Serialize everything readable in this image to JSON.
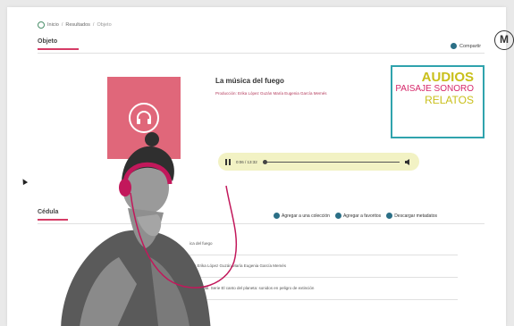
{
  "breadcrumb": {
    "home": "Inicio",
    "sep": "/",
    "results": "Resultados",
    "current": "Objeto"
  },
  "sections": {
    "objeto": "Objeto",
    "cedula": "Cédula"
  },
  "share_label": "Compartir",
  "brand_initial": "M",
  "item": {
    "title": "La música del fuego",
    "credit": "Producción: Erika López Guzán  María Eugenia García Memés"
  },
  "promo": {
    "line1": "AUDIOS",
    "line2": "PAISAJE SONORO",
    "line3": "RELATOS"
  },
  "player": {
    "time": "0:06 / 13:32",
    "progress": 0.0
  },
  "actions": {
    "add_collection": "Agregar a una colección",
    "add_favorites": "Agregar a favoritos",
    "download_metadata": "Descargar metadatos"
  },
  "cedula_rows": [
    "ica del fuego",
    "ión: Erika López Guzán  María Eugenia García Memés",
    "a Nacional. Serie El canto del planeta: sonidos en peligro de extinción"
  ],
  "colors": {
    "accent": "#d63c66",
    "teal": "#2b6f86",
    "promo_border": "#2fa3ad",
    "promo_yellow": "#c9bf1a",
    "promo_pink": "#d6286a"
  },
  "icons": {
    "headphones": "headphones-icon",
    "pause": "pause-icon",
    "volume": "volume-icon"
  }
}
